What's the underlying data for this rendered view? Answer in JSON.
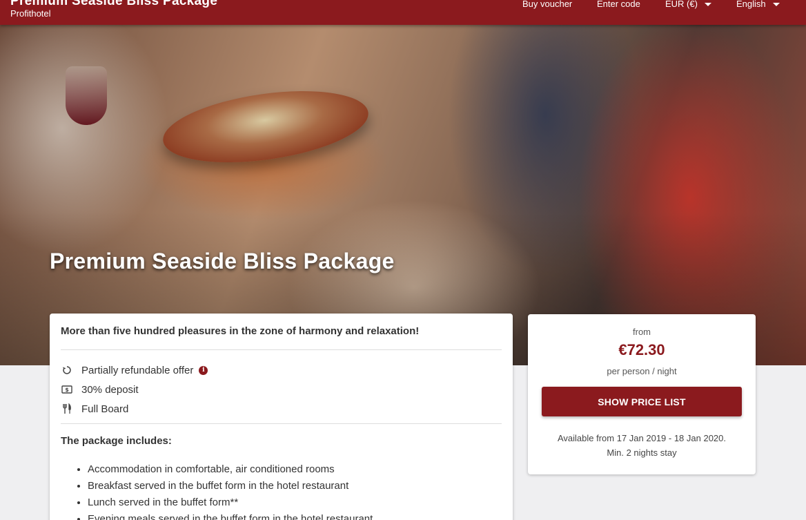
{
  "header": {
    "title": "Premium Seaside Bliss Package",
    "subtitle": "Profithotel",
    "nav": {
      "buy_voucher": "Buy voucher",
      "enter_code": "Enter code",
      "currency": "EUR (€)",
      "language": "English"
    }
  },
  "hero": {
    "title": "Premium Seaside Bliss Package"
  },
  "main": {
    "tagline": "More than five hundred pleasures in the zone of harmony and relaxation!",
    "features": [
      {
        "icon": "refresh-icon",
        "label": "Partially refundable offer"
      },
      {
        "icon": "money-icon",
        "label": "30% deposit"
      },
      {
        "icon": "cutlery-icon",
        "label": "Full Board"
      }
    ],
    "includes_title": "The package includes:",
    "includes": [
      "Accommodation in comfortable, air conditioned rooms",
      "Breakfast served in the buffet form in the hotel restaurant",
      "Lunch served in the buffet form**",
      "Evening meals served in the buffet form in the hotel restaurant"
    ]
  },
  "price": {
    "from": "from",
    "amount": "€72.30",
    "unit": "per person / night",
    "button": "SHOW PRICE LIST",
    "availability": "Available from 17 Jan 2019 - 18 Jan 2020.",
    "min_stay": "Min. 2 nights stay"
  },
  "colors": {
    "brand": "#8b1a1e",
    "page_bg": "#efeff1"
  }
}
